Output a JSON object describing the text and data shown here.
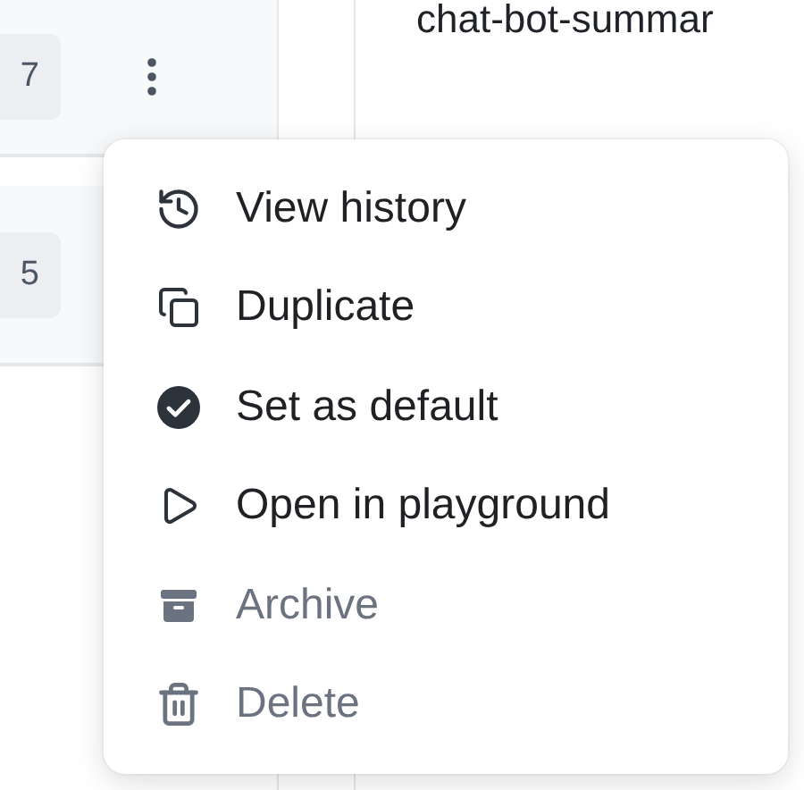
{
  "versions": [
    {
      "badge": "7"
    },
    {
      "badge": "5"
    }
  ],
  "editor": {
    "top_text": "chat-bot-summar"
  },
  "menu": {
    "items": [
      {
        "kind": "history",
        "label": "View history",
        "disabled": false
      },
      {
        "kind": "duplicate",
        "label": "Duplicate",
        "disabled": false
      },
      {
        "kind": "default",
        "label": "Set as default",
        "disabled": false
      },
      {
        "kind": "playground",
        "label": "Open in playground",
        "disabled": false
      },
      {
        "kind": "archive",
        "label": "Archive",
        "disabled": true
      },
      {
        "kind": "delete",
        "label": "Delete",
        "disabled": true
      }
    ]
  }
}
